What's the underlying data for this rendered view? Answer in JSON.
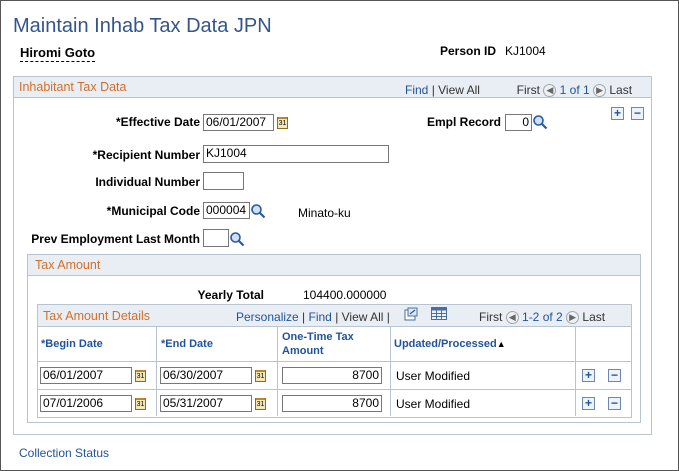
{
  "page": {
    "title": "Maintain Inhab Tax Data JPN",
    "employee_name": "Hiromi Goto",
    "person_id_label": "Person ID",
    "person_id_value": "KJ1004"
  },
  "inhabitant_section": {
    "title": "Inhabitant Tax Data",
    "find": "Find",
    "view_all": "View All",
    "first": "First",
    "range": "1 of 1",
    "last": "Last",
    "fields": {
      "effective_date_label": "*Effective Date",
      "effective_date_value": "06/01/2007",
      "empl_record_label": "Empl Record",
      "empl_record_value": "0",
      "recipient_number_label": "*Recipient Number",
      "recipient_number_value": "KJ1004",
      "individual_number_label": "Individual Number",
      "individual_number_value": "",
      "municipal_code_label": "*Municipal Code",
      "municipal_code_value": "000004",
      "municipal_name": "Minato-ku",
      "prev_employment_label": "Prev Employment Last Month",
      "prev_employment_value": ""
    }
  },
  "tax_amount": {
    "title": "Tax Amount",
    "yearly_total_label": "Yearly Total",
    "yearly_total_value": "104400.000000"
  },
  "tax_details": {
    "title": "Tax Amount Details",
    "personalize": "Personalize",
    "find": "Find",
    "view_all": "View All",
    "first": "First",
    "range": "1-2 of 2",
    "last": "Last",
    "columns": {
      "begin_date": "*Begin Date",
      "end_date": "*End Date",
      "one_time_tax_line1": "One-Time Tax",
      "one_time_tax_line2": "Amount",
      "updated": "Updated/Processed"
    },
    "rows": [
      {
        "begin": "06/01/2007",
        "end": "06/30/2007",
        "amount": "8700",
        "status": "User Modified"
      },
      {
        "begin": "07/01/2006",
        "end": "05/31/2007",
        "amount": "8700",
        "status": "User Modified"
      }
    ]
  },
  "footer": {
    "collection_status": "Collection Status"
  },
  "colors": {
    "title_blue": "#33558c",
    "section_orange": "#d1702a",
    "link_blue": "#21539c",
    "header_bg": "#e9eef4"
  }
}
